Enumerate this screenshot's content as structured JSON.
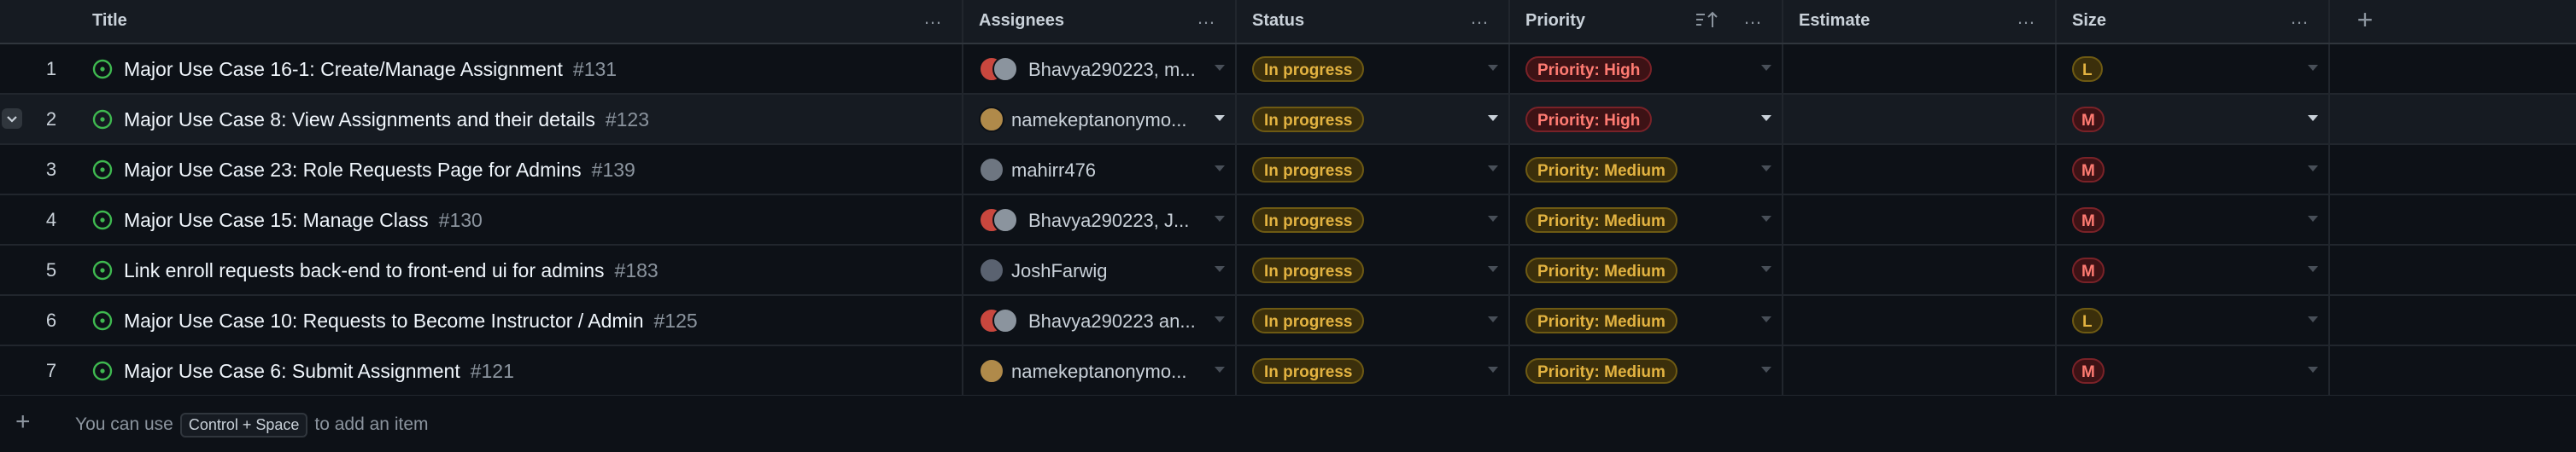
{
  "columns": {
    "title": "Title",
    "assignees": "Assignees",
    "status": "Status",
    "priority": "Priority",
    "estimate": "Estimate",
    "size": "Size"
  },
  "rows": [
    {
      "num": "1",
      "title": "Major Use Case 16-1: Create/Manage Assignment",
      "issue": "#131",
      "assignees": "Bhavya290223, m...",
      "status": "In progress",
      "priority": "Priority: High",
      "estimate": "",
      "size": "L"
    },
    {
      "num": "2",
      "title": "Major Use Case 8: View Assignments and their details",
      "issue": "#123",
      "assignees": "namekeptanonymo...",
      "status": "In progress",
      "priority": "Priority: High",
      "estimate": "",
      "size": "M"
    },
    {
      "num": "3",
      "title": "Major Use Case 23: Role Requests Page for Admins",
      "issue": "#139",
      "assignees": "mahirr476",
      "status": "In progress",
      "priority": "Priority: Medium",
      "estimate": "",
      "size": "M"
    },
    {
      "num": "4",
      "title": "Major Use Case 15: Manage Class",
      "issue": "#130",
      "assignees": "Bhavya290223, J...",
      "status": "In progress",
      "priority": "Priority: Medium",
      "estimate": "",
      "size": "M"
    },
    {
      "num": "5",
      "title": "Link enroll requests back-end to front-end ui for admins",
      "issue": "#183",
      "assignees": "JoshFarwig",
      "status": "In progress",
      "priority": "Priority: Medium",
      "estimate": "",
      "size": "M"
    },
    {
      "num": "6",
      "title": "Major Use Case 10: Requests to Become Instructor / Admin",
      "issue": "#125",
      "assignees": "Bhavya290223 an...",
      "status": "In progress",
      "priority": "Priority: Medium",
      "estimate": "",
      "size": "L"
    },
    {
      "num": "7",
      "title": "Major Use Case 6: Submit Assignment",
      "issue": "#121",
      "assignees": "namekeptanonymo...",
      "status": "In progress",
      "priority": "Priority: Medium",
      "estimate": "",
      "size": "M"
    }
  ],
  "footer": {
    "prefix": "You can use",
    "shortcut": "Control + Space",
    "suffix": "to add an item"
  },
  "icons": {
    "column_menu": "…",
    "sort": "sort-ascending-icon",
    "add_column": "+",
    "add_item": "+"
  },
  "colors": {
    "background": "#0d1117",
    "open_issue_green": "#3fb950",
    "in_progress_yellow": "#e3b341",
    "high_red": "#ff7b72"
  }
}
